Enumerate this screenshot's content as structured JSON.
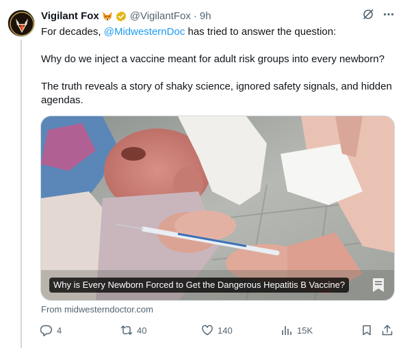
{
  "author": {
    "display_name": "Vigilant Fox",
    "name_emoji": "fox-icon",
    "verified_badge": "gold-verified-icon",
    "handle": "@VigilantFox",
    "separator": "·",
    "time": "9h"
  },
  "tweet": {
    "line1_prefix": "For decades, ",
    "mention": "@MidwesternDoc",
    "line1_suffix": " has tried to answer the question:",
    "paragraph2": "Why do we inject a vaccine meant for adult risk groups into every newborn?",
    "paragraph3": "The truth reveals a story of shaky science, ignored safety signals, and hidden agendas."
  },
  "card": {
    "caption": "Why is Every Newborn Forced to Get the Dangerous Hepatitis B Vaccine?",
    "source": "From midwesterndoctor.com"
  },
  "actions": {
    "replies": "4",
    "reposts": "40",
    "likes": "140",
    "views": "15K"
  },
  "colors": {
    "text": "#0f1419",
    "secondary": "#536471",
    "link": "#1d9bf0",
    "border": "#cfd9de",
    "verified_gold": "#e2b719"
  }
}
